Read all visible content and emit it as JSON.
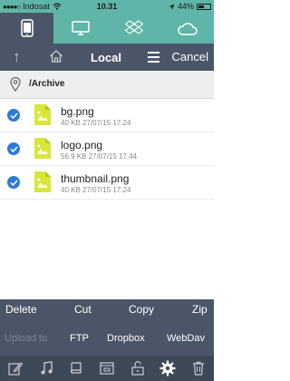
{
  "status": {
    "carrier": "Indosat",
    "time": "10.31",
    "battery": "44%"
  },
  "tabs": [
    {
      "name": "device",
      "icon": "phone-icon",
      "active": true
    },
    {
      "name": "computer",
      "icon": "monitor-icon",
      "active": false
    },
    {
      "name": "dropbox",
      "icon": "dropbox-icon",
      "active": false
    },
    {
      "name": "cloud",
      "icon": "cloud-icon",
      "active": false
    }
  ],
  "nav": {
    "title": "Local",
    "cancel_label": "Cancel"
  },
  "path": "/Archive",
  "files": [
    {
      "name": "bg.png",
      "meta": "40 KB 27/07/15 17.24",
      "selected": true
    },
    {
      "name": "logo.png",
      "meta": "56.9 KB 27/07/15 17.44",
      "selected": true
    },
    {
      "name": "thumbnail.png",
      "meta": "40 KB 27/07/15 17.24",
      "selected": true
    }
  ],
  "actions": {
    "delete": "Delete",
    "cut": "Cut",
    "copy": "Copy",
    "zip": "Zip"
  },
  "upload": {
    "label": "Upload to",
    "ftp": "FTP",
    "dropbox": "Dropbox",
    "webdav": "WebDav"
  },
  "colors": {
    "teal": "#5fb6a8",
    "slate": "#4a5668",
    "check_blue": "#2e7bd6",
    "file_yellow": "#d8e63a"
  }
}
